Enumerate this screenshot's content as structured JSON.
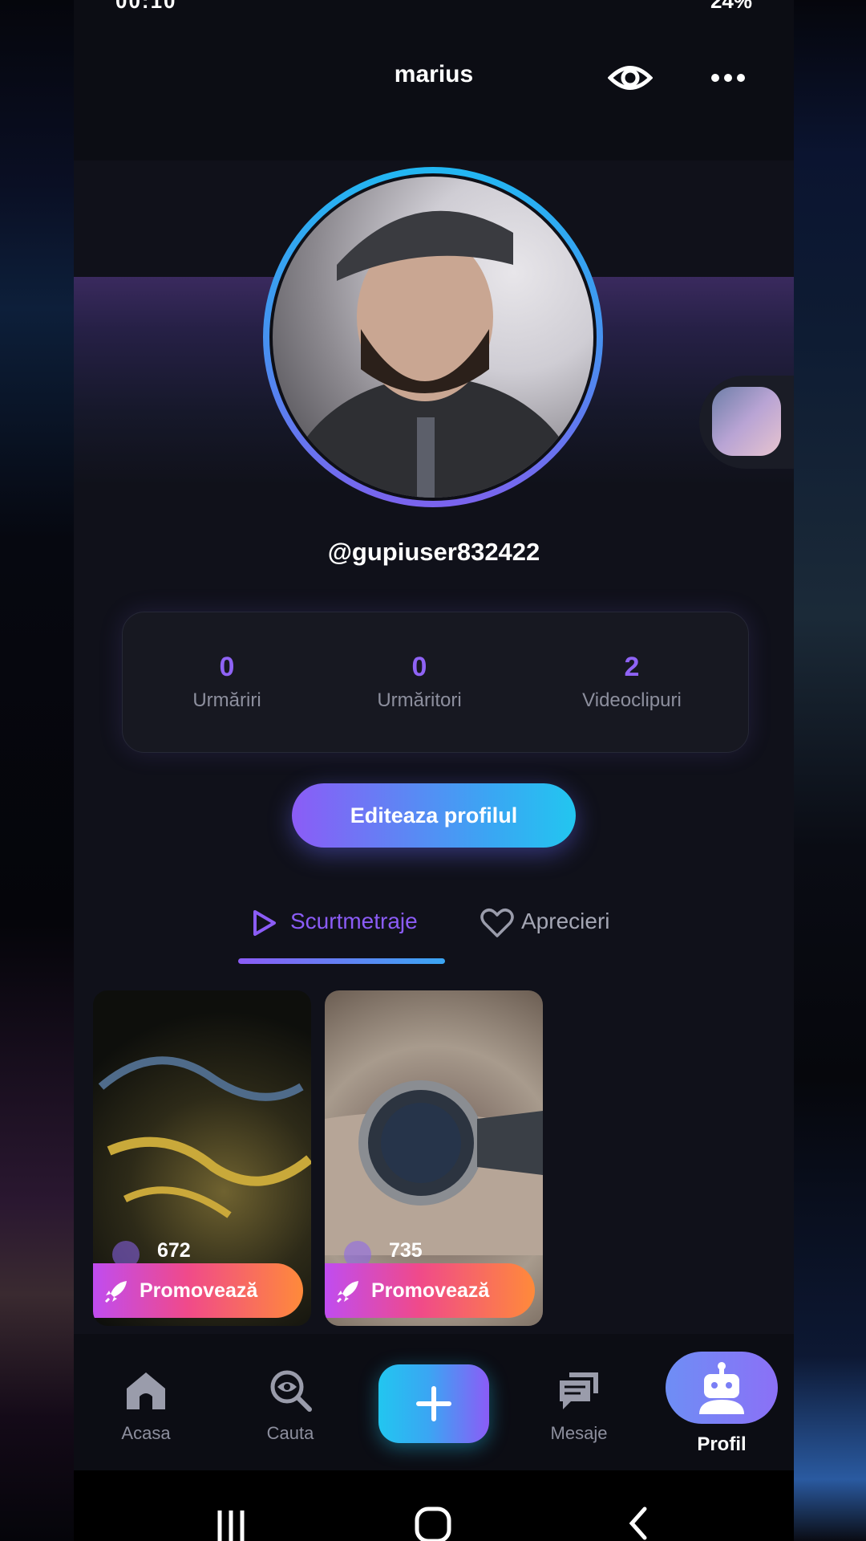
{
  "status_bar": {
    "time_partial": "00:10",
    "right_partial": "24%"
  },
  "header": {
    "title": "marius",
    "eye_icon": "eye-icon",
    "more_icon": "more-horizontal-icon"
  },
  "profile": {
    "username": "@gupiuser832422"
  },
  "stats": [
    {
      "value": "0",
      "label": "Urmăriri"
    },
    {
      "value": "0",
      "label": "Urmăritori"
    },
    {
      "value": "2",
      "label": "Videoclipuri"
    }
  ],
  "edit_button": {
    "label": "Editeaza profilul"
  },
  "tabs": [
    {
      "label": "Scurtmetraje",
      "icon": "play-icon",
      "active": true
    },
    {
      "label": "Aprecieri",
      "icon": "heart-icon",
      "active": false
    }
  ],
  "videos": [
    {
      "views": "672",
      "promo_label": "Promovează"
    },
    {
      "views": "735",
      "promo_label": "Promovează"
    }
  ],
  "bottom_nav": [
    {
      "label": "Acasa",
      "icon": "home-icon"
    },
    {
      "label": "Cauta",
      "icon": "search-eye-icon"
    },
    {
      "label": "",
      "icon": "plus-icon"
    },
    {
      "label": "Mesaje",
      "icon": "chat-icon"
    },
    {
      "label": "Profil",
      "icon": "robot-icon"
    }
  ],
  "colors": {
    "accent_purple": "#8f63f5",
    "accent_cyan": "#22c6f0",
    "background": "#10111a"
  }
}
